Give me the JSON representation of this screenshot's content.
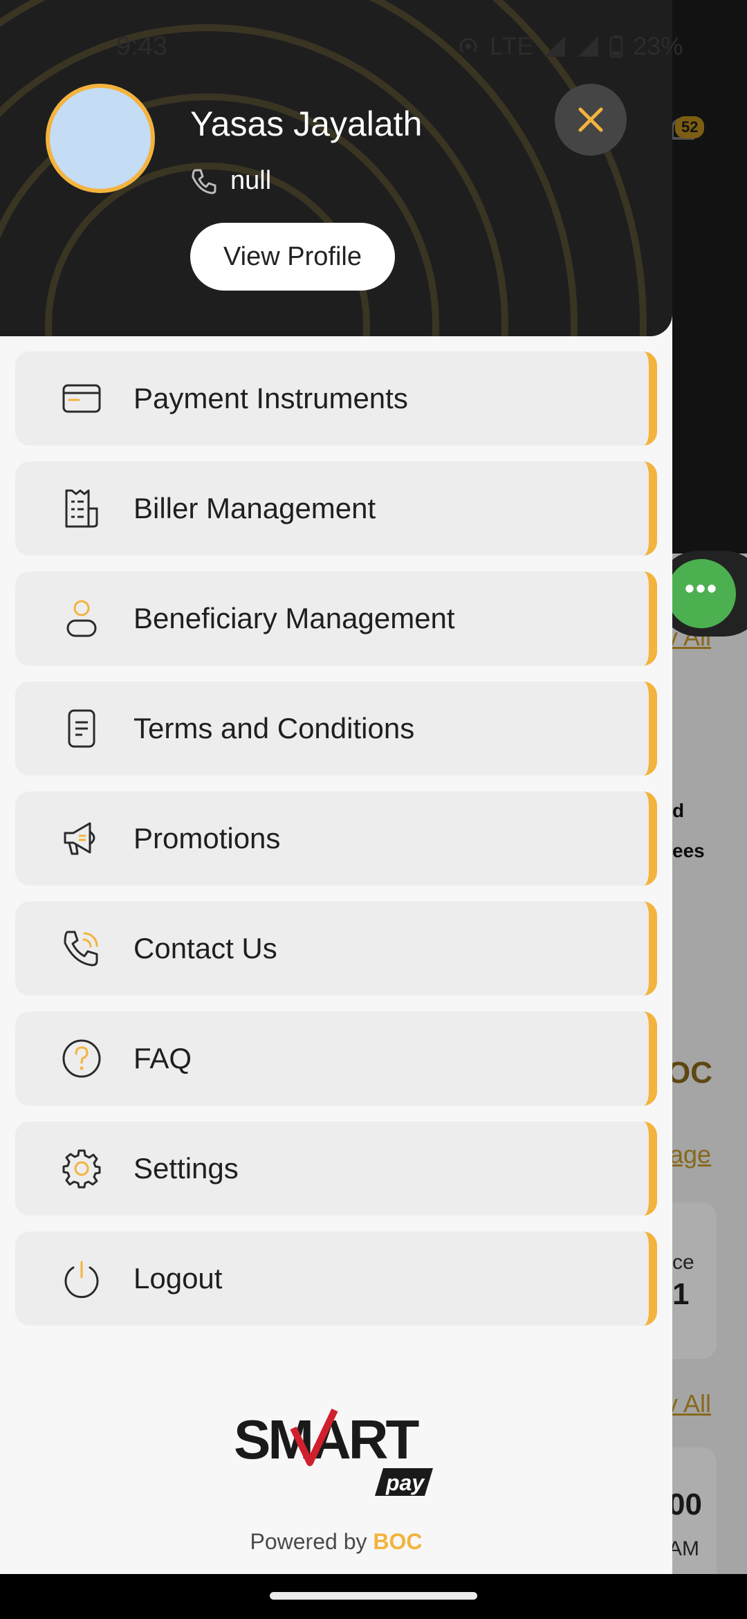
{
  "status_bar": {
    "time": "9:43",
    "network": "LTE",
    "battery": "23%"
  },
  "background": {
    "notification_count": "52",
    "link_view_all_top": "v All",
    "partial_text_1": "d",
    "partial_text_2": "ees",
    "partial_logo_text": "OC",
    "link_manage": "age",
    "balance_label": "ce",
    "balance_value": "1",
    "link_view_all_bottom": "v All",
    "amount_partial": "00",
    "time_partial": "AM"
  },
  "drawer": {
    "user_name": "Yasas Jayalath",
    "phone": "null",
    "view_profile_label": "View Profile",
    "menu_items": [
      {
        "label": "Payment Instruments",
        "icon": "card-icon"
      },
      {
        "label": "Biller Management",
        "icon": "bill-icon"
      },
      {
        "label": "Beneficiary Management",
        "icon": "person-icon"
      },
      {
        "label": "Terms and Conditions",
        "icon": "document-icon"
      },
      {
        "label": "Promotions",
        "icon": "megaphone-icon"
      },
      {
        "label": "Contact Us",
        "icon": "phone-call-icon"
      },
      {
        "label": "FAQ",
        "icon": "question-icon"
      },
      {
        "label": "Settings",
        "icon": "gear-icon"
      },
      {
        "label": "Logout",
        "icon": "power-icon"
      }
    ],
    "logo": {
      "line1": "SMART",
      "line2": "pay"
    },
    "powered_by": "Powered by",
    "powered_brand": "BOC"
  },
  "colors": {
    "accent": "#f3b33d",
    "header_bg": "#1e1e1e",
    "menu_item_bg": "#ededed",
    "fab": "#4caf50",
    "logo_red": "#d0202e"
  }
}
